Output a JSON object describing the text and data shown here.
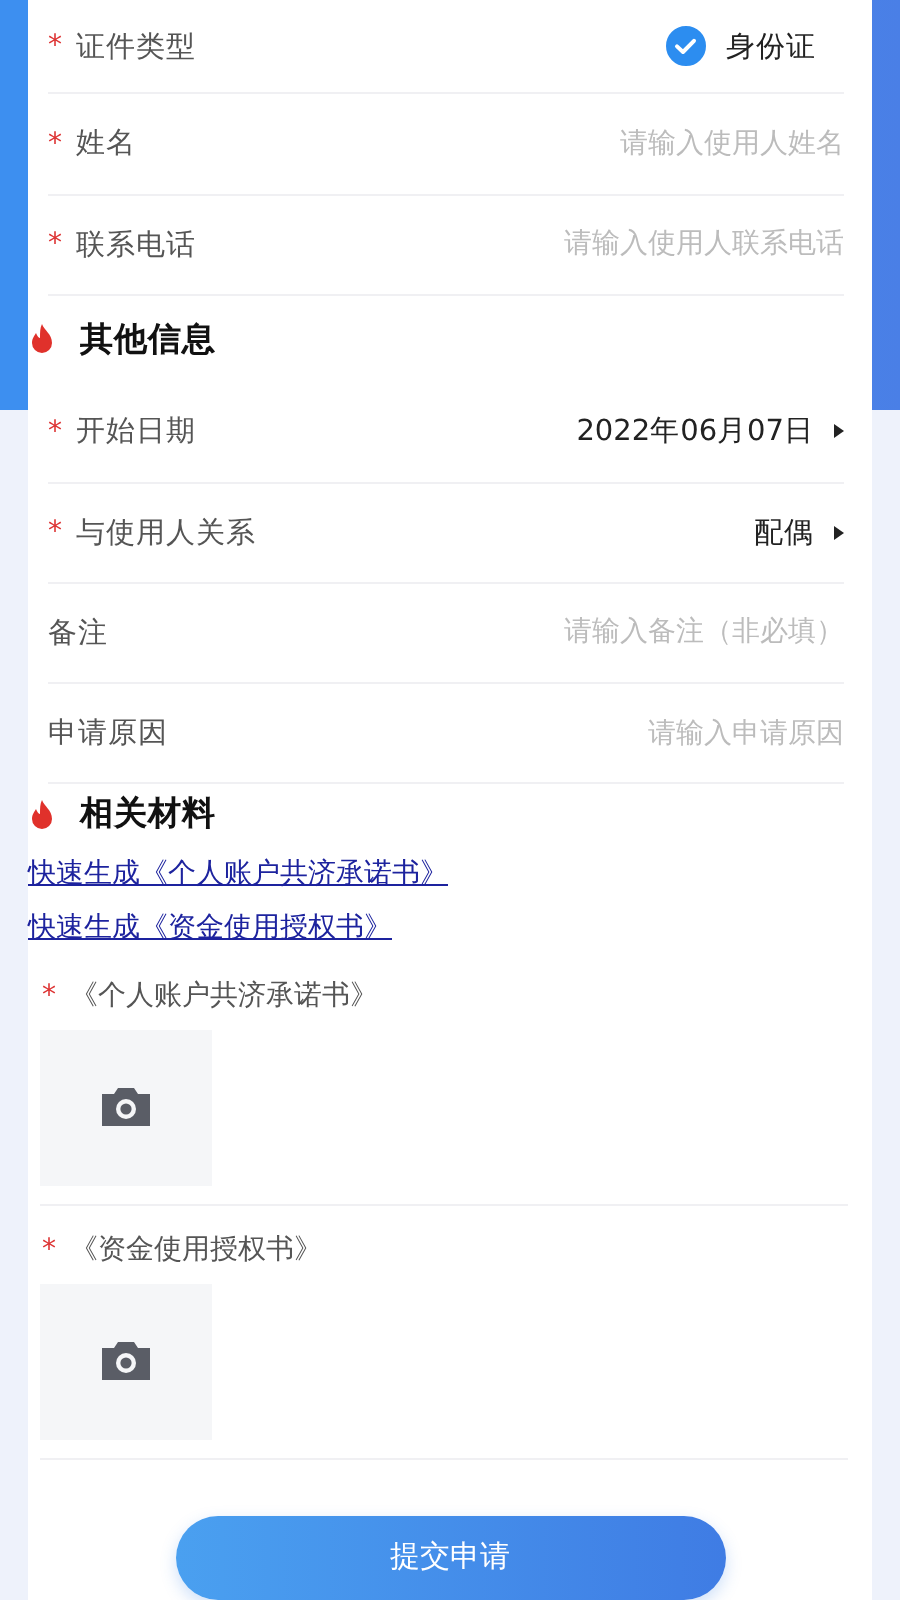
{
  "identity_fields": [
    {
      "kind": "check",
      "label": "证件类型",
      "mark": "*",
      "value": "身份证",
      "checked": true
    },
    {
      "kind": "input",
      "label": "姓名",
      "mark": "*",
      "placeholder": "请输入使用人姓名"
    },
    {
      "kind": "input",
      "label": "联系电话",
      "mark": "*",
      "placeholder": "请输入使用人联系电话"
    }
  ],
  "other_info": {
    "title": "其他信息",
    "fields": [
      {
        "kind": "select",
        "label": "开始日期",
        "mark": "*",
        "value": "2022年06月07日"
      },
      {
        "kind": "select",
        "label": "与使用人关系",
        "mark": "*",
        "value": "配偶"
      },
      {
        "kind": "input",
        "label": "备注",
        "placeholder": "请输入备注（非必填）"
      },
      {
        "kind": "input",
        "label": "申请原因",
        "placeholder": "请输入申请原因"
      }
    ]
  },
  "materials": {
    "title": "相关材料",
    "links": [
      "快速生成《个人账户共济承诺书》",
      "快速生成《资金使用授权书》"
    ],
    "uploads": [
      {
        "label": "《个人账户共济承诺书》",
        "mark": "*"
      },
      {
        "label": "《资金使用授权书》",
        "mark": "*"
      }
    ]
  },
  "submit_button": "提交申请"
}
